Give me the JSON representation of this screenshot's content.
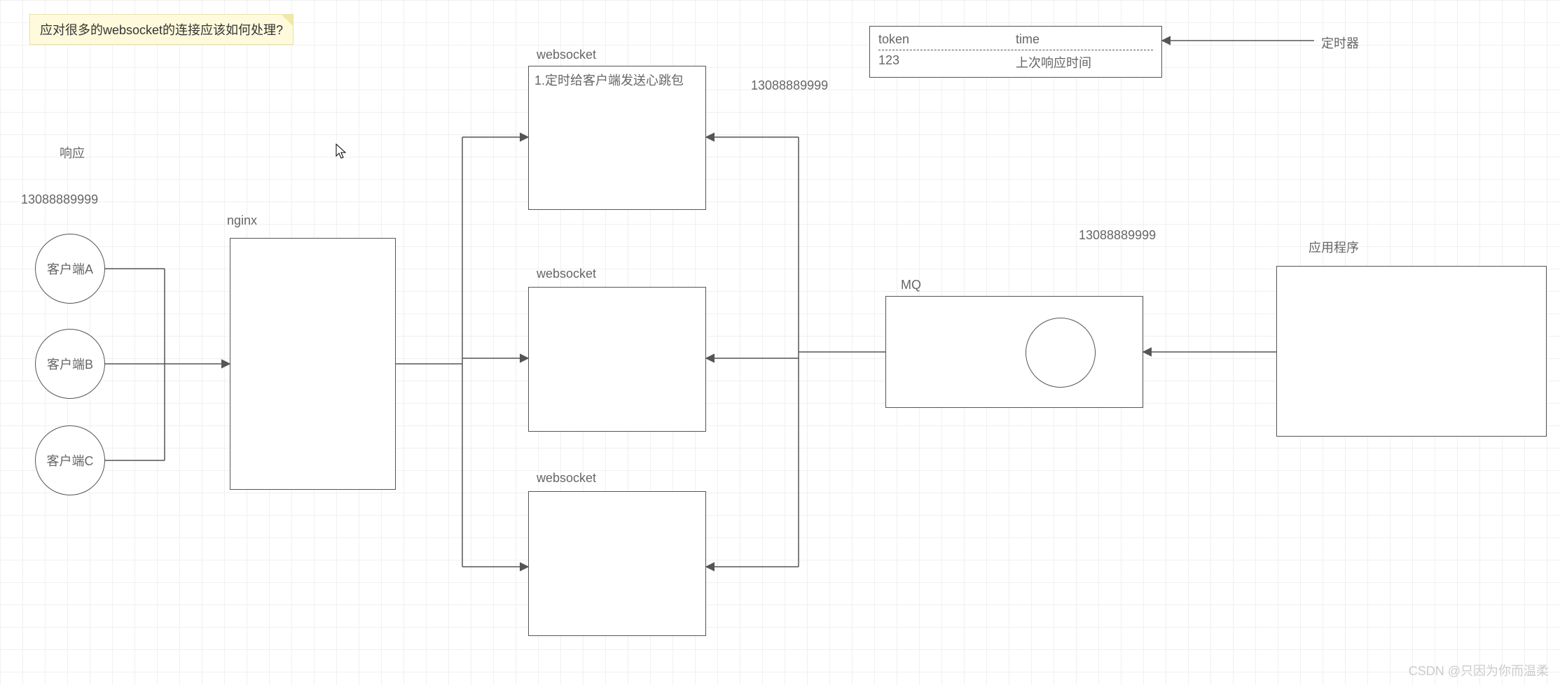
{
  "note": {
    "text": "应对很多的websocket的连接应该如何处理?"
  },
  "labels": {
    "response": "响应",
    "phone1": "13088889999",
    "nginx": "nginx",
    "ws1": "websocket",
    "ws2": "websocket",
    "ws3": "websocket",
    "heartbeat": "1.定时给客户端发送心跳包",
    "phone2": "13088889999",
    "mq": "MQ",
    "phone3": "13088889999",
    "app": "应用程序",
    "timer": "定时器"
  },
  "clients": {
    "a": "客户端A",
    "b": "客户端B",
    "c": "客户端C"
  },
  "table": {
    "h1": "token",
    "h2": "time",
    "v1": "123",
    "v2": "上次响应时间"
  },
  "watermark": "CSDN @只因为你而温柔"
}
